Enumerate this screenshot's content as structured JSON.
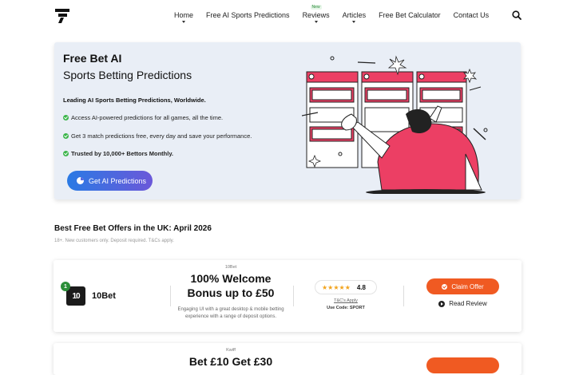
{
  "nav": {
    "items": [
      {
        "label": "Home"
      },
      {
        "label": "Free AI Sports Predictions"
      },
      {
        "label": "Reviews",
        "badge": "New"
      },
      {
        "label": "Articles"
      },
      {
        "label": "Free Bet Calculator"
      },
      {
        "label": "Contact Us"
      }
    ]
  },
  "hero": {
    "title": "Free Bet AI",
    "subtitle": "Sports Betting Predictions",
    "lead": "Leading AI Sports Betting Predictions, Worldwide.",
    "bullets": [
      "Access AI-powered predictions for all games, all the time.",
      "Get 3 match predictions free, every day and save your performance.",
      "Trusted by 10,000+ Bettors Monthly."
    ],
    "cta": "Get AI Predictions"
  },
  "offers": {
    "title": "Best Free Bet Offers in the UK: April 2026",
    "note": "18+. New customers only. Deposit required. T&Cs apply.",
    "cards": [
      {
        "rank": "1",
        "brand": "10Bet",
        "logo_text": "10",
        "tag": "10Bet",
        "headline_1": "100% Welcome",
        "headline_2": "Bonus up to £50",
        "description": "Engaging UI with a great desktop & mobile betting experience with a range of deposit options.",
        "rating": "4.8",
        "stars": "★★★★★",
        "tcs": "T&C's Apply",
        "code": "Use Code: SPORT",
        "claim": "Claim Offer",
        "review": "Read Review"
      },
      {
        "tag": "Kwiff",
        "headline_1": "Bet £10 Get £30"
      }
    ]
  },
  "colors": {
    "accent": "#f05a22",
    "cta_start": "#2a7ae4",
    "cta_end": "#6b58d9",
    "hero_bg": "#e9eef6",
    "check": "#3bb54a",
    "illustration_pink": "#ec3f64"
  }
}
